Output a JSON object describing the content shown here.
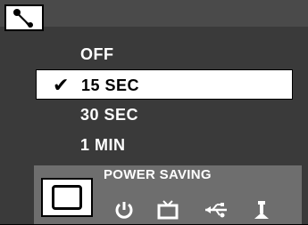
{
  "header": {
    "icon": "wrench-icon"
  },
  "menu": {
    "items": [
      {
        "label": "OFF",
        "selected": false
      },
      {
        "label": "15 SEC",
        "selected": true
      },
      {
        "label": "30 SEC",
        "selected": false
      },
      {
        "label": "1 MIN",
        "selected": false
      }
    ]
  },
  "footer": {
    "title": "POWER SAVING",
    "icons": [
      "power-icon",
      "tv-icon",
      "usb-icon",
      "tripod-icon"
    ]
  },
  "colors": {
    "background": "#3a3a3a",
    "selected_row": "#ffffff",
    "footer_background": "#6e6e6e"
  }
}
